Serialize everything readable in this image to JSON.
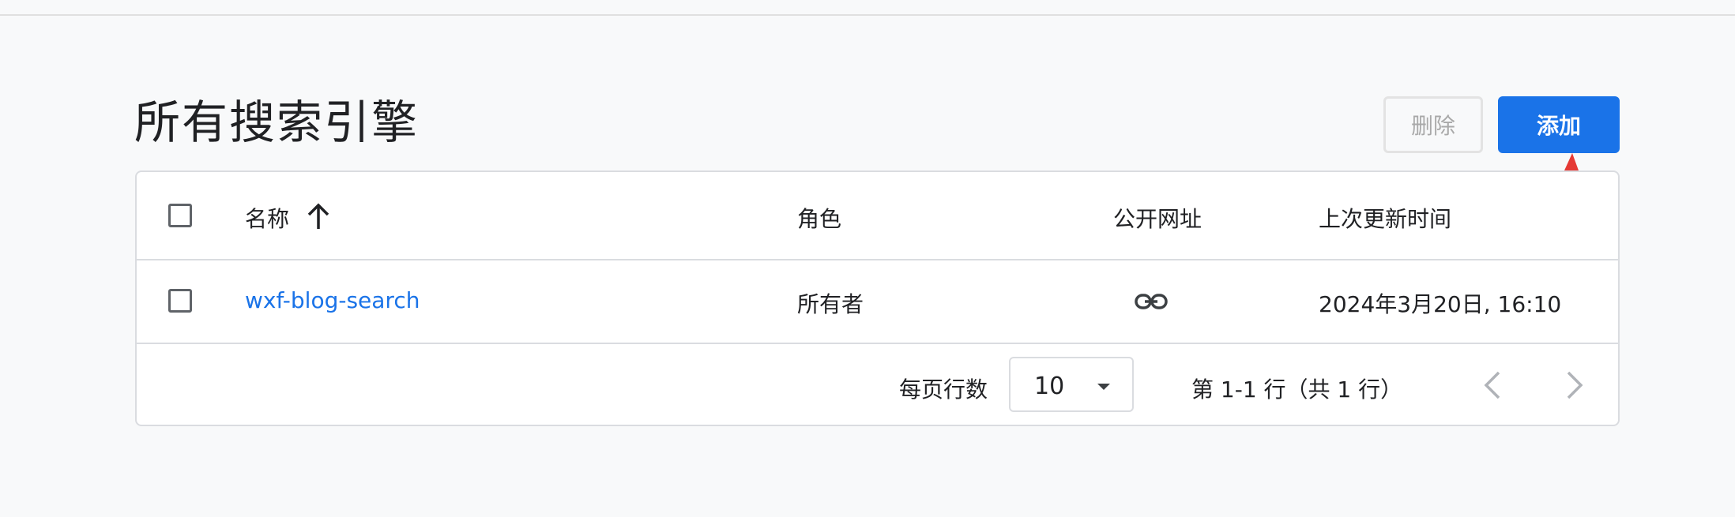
{
  "page": {
    "title": "所有搜索引擎"
  },
  "toolbar": {
    "delete_label": "删除",
    "add_label": "添加"
  },
  "table": {
    "columns": {
      "name": "名称",
      "role": "角色",
      "public_url": "公开网址",
      "last_updated": "上次更新时间"
    },
    "rows": [
      {
        "name": "wxf-blog-search",
        "role": "所有者",
        "last_updated": "2024年3月20日, 16:10"
      }
    ]
  },
  "pagination": {
    "rows_per_page_label": "每页行数",
    "rows_per_page_value": "10",
    "range_label": "第 1-1 行（共 1 行）"
  },
  "colors": {
    "accent": "#1a73e8",
    "annotation_arrow": "#e53935"
  },
  "icons": {
    "sort": "arrow-up-icon",
    "public_url": "link-icon",
    "select_caret": "caret-down-icon",
    "prev_page": "chevron-left-icon",
    "next_page": "chevron-right-icon"
  }
}
